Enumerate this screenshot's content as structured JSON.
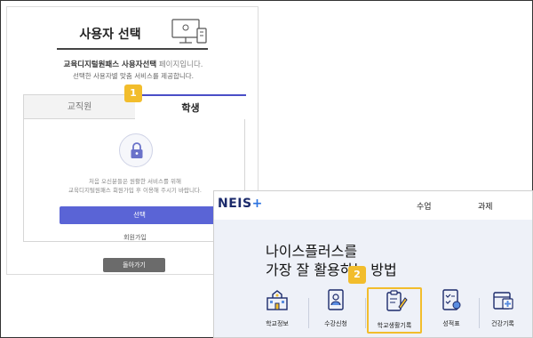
{
  "user_select": {
    "title": "사용자 선택",
    "desc_bold": "교육디지털원패스 사용자선택",
    "desc_light": " 페이지입니다.",
    "desc2": "선택한 사용자별 맞춤 서비스를 제공합니다.",
    "tabs": [
      {
        "label": "교직원",
        "active": false
      },
      {
        "label": "학생",
        "active": true
      }
    ],
    "message_line1": "처음 오신분들은 원활한 서비스를 위해",
    "message_line2": "교육디지털원패스 회원가입 후 이용해 주시기 바랍니다.",
    "select_button": "선택",
    "signup_link": "회원가입",
    "back_button": "돌아가기"
  },
  "badges": {
    "step1": "1",
    "step2": "2"
  },
  "neis": {
    "logo_text": "NEIS",
    "logo_plus": "+",
    "nav": [
      "수업",
      "과제"
    ],
    "headline_line1": "나이스플러스를",
    "headline_line2": "가장 잘 활용하는 방법",
    "menu": [
      {
        "label": "학교정보",
        "icon": "school-building-icon",
        "highlight": false
      },
      {
        "label": "수강신청",
        "icon": "id-card-icon",
        "highlight": false
      },
      {
        "label": "학교생활기록",
        "icon": "clipboard-pen-icon",
        "highlight": true
      },
      {
        "label": "성적표",
        "icon": "checklist-icon",
        "highlight": false
      },
      {
        "label": "건강기록",
        "icon": "medical-calendar-icon",
        "highlight": false
      }
    ]
  },
  "colors": {
    "accent_blue": "#4a4ec7",
    "button_blue": "#5a64d6",
    "badge_yellow": "#f2bd2c",
    "neis_navy": "#1b2a6b",
    "neis_body_bg": "#eef1f8"
  }
}
